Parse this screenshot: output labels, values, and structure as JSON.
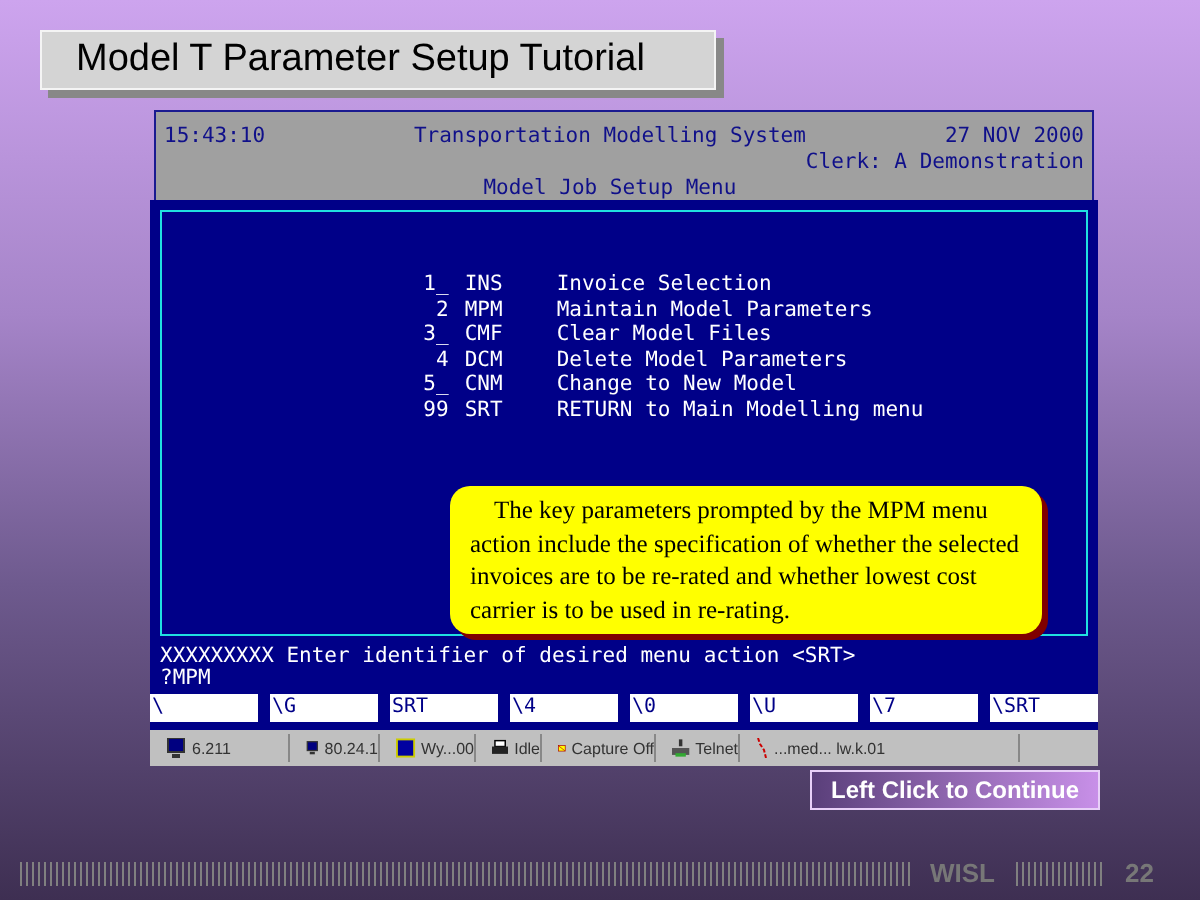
{
  "slide_title": "Model T Parameter Setup Tutorial",
  "terminal": {
    "time": "15:43:10",
    "system_title": "Transportation Modelling System",
    "date": "27 NOV 2000",
    "clerk": "Clerk: A Demonstration",
    "menu_title": "Model Job Setup Menu",
    "menu_items": [
      {
        "number": "1_",
        "code": "INS",
        "label": "Invoice Selection"
      },
      {
        "number": "2",
        "code": "MPM",
        "label": "Maintain Model Parameters"
      },
      {
        "number": "3_",
        "code": "CMF",
        "label": "Clear Model Files"
      },
      {
        "number": "4",
        "code": "DCM",
        "label": "Delete Model Parameters"
      },
      {
        "number": "5_",
        "code": "CNM",
        "label": "Change to New Model"
      },
      {
        "number": "99",
        "code": "SRT",
        "label": "RETURN to Main Modelling menu"
      }
    ],
    "prompt": "XXXXXXXXX Enter identifier of desired menu action <SRT>",
    "input": "?MPM",
    "function_keys": [
      "\\",
      "\\G",
      "SRT",
      "\\4",
      "\\0",
      "\\U",
      "\\7",
      "\\SRT"
    ],
    "taskbar": [
      {
        "kind": "monitor",
        "label": "6.211"
      },
      {
        "kind": "monitor",
        "label": "80.24.1"
      },
      {
        "kind": "window",
        "label": "Wy...00"
      },
      {
        "kind": "printer",
        "label": "Idle"
      },
      {
        "kind": "capture",
        "label": "Capture Off"
      },
      {
        "kind": "telnet",
        "label": "Telnet"
      },
      {
        "kind": "link",
        "label": "...med...  lw.k.01"
      }
    ]
  },
  "callout": "The key parameters prompted by the MPM menu action include the specification of whether the selected invoices are to be re-rated and whether lowest cost carrier is to be used in re-rating.",
  "continue_button": "Left Click to Continue",
  "footer": {
    "brand": "WISL",
    "page": "22"
  }
}
